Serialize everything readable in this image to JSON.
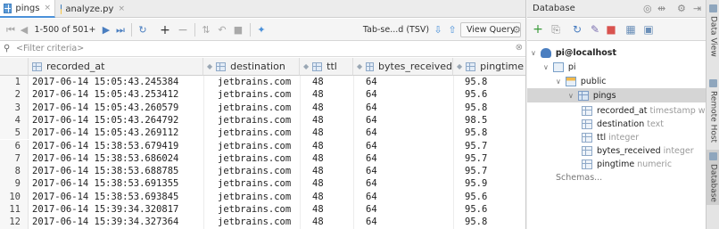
{
  "editor": {
    "tabs": [
      {
        "label": "pings",
        "active": true,
        "icon": "table-icon"
      },
      {
        "label": "analyze.py",
        "active": false,
        "icon": "python-file-icon"
      }
    ],
    "close_glyph": "×",
    "toolbar": {
      "range": "1-500 of 501+",
      "format": "Tab-se...d (TSV)",
      "view_query": "View Query"
    },
    "filter_placeholder": "<Filter criteria>",
    "columns": [
      {
        "name": "recorded_at"
      },
      {
        "name": "destination"
      },
      {
        "name": "ttl"
      },
      {
        "name": "bytes_received"
      },
      {
        "name": "pingtime"
      }
    ],
    "rows": [
      {
        "n": "1",
        "recorded_at": "2017-06-14 15:05:43.245384",
        "destination": "jetbrains.com",
        "ttl": "48",
        "bytes_received": "64",
        "pingtime": "95.8"
      },
      {
        "n": "2",
        "recorded_at": "2017-06-14 15:05:43.253412",
        "destination": "jetbrains.com",
        "ttl": "48",
        "bytes_received": "64",
        "pingtime": "95.6"
      },
      {
        "n": "3",
        "recorded_at": "2017-06-14 15:05:43.260579",
        "destination": "jetbrains.com",
        "ttl": "48",
        "bytes_received": "64",
        "pingtime": "95.8"
      },
      {
        "n": "4",
        "recorded_at": "2017-06-14 15:05:43.264792",
        "destination": "jetbrains.com",
        "ttl": "48",
        "bytes_received": "64",
        "pingtime": "98.5"
      },
      {
        "n": "5",
        "recorded_at": "2017-06-14 15:05:43.269112",
        "destination": "jetbrains.com",
        "ttl": "48",
        "bytes_received": "64",
        "pingtime": "95.8"
      },
      {
        "n": "6",
        "recorded_at": "2017-06-14 15:38:53.679419",
        "destination": "jetbrains.com",
        "ttl": "48",
        "bytes_received": "64",
        "pingtime": "95.7"
      },
      {
        "n": "7",
        "recorded_at": "2017-06-14 15:38:53.686024",
        "destination": "jetbrains.com",
        "ttl": "48",
        "bytes_received": "64",
        "pingtime": "95.7"
      },
      {
        "n": "8",
        "recorded_at": "2017-06-14 15:38:53.688785",
        "destination": "jetbrains.com",
        "ttl": "48",
        "bytes_received": "64",
        "pingtime": "95.7"
      },
      {
        "n": "9",
        "recorded_at": "2017-06-14 15:38:53.691355",
        "destination": "jetbrains.com",
        "ttl": "48",
        "bytes_received": "64",
        "pingtime": "95.9"
      },
      {
        "n": "10",
        "recorded_at": "2017-06-14 15:38:53.693845",
        "destination": "jetbrains.com",
        "ttl": "48",
        "bytes_received": "64",
        "pingtime": "95.6"
      },
      {
        "n": "11",
        "recorded_at": "2017-06-14 15:39:34.320817",
        "destination": "jetbrains.com",
        "ttl": "48",
        "bytes_received": "64",
        "pingtime": "95.6"
      },
      {
        "n": "12",
        "recorded_at": "2017-06-14 15:39:34.327364",
        "destination": "jetbrains.com",
        "ttl": "48",
        "bytes_received": "64",
        "pingtime": "95.8"
      }
    ]
  },
  "database": {
    "title": "Database",
    "tree": {
      "connection": "pi@localhost",
      "database": "pi",
      "schema": "public",
      "table": "pings",
      "columns": [
        {
          "name": "recorded_at",
          "type": "timestamp wit"
        },
        {
          "name": "destination",
          "type": "text"
        },
        {
          "name": "ttl",
          "type": "integer"
        },
        {
          "name": "bytes_received",
          "type": "integer"
        },
        {
          "name": "pingtime",
          "type": "numeric"
        }
      ],
      "schemas_label": "Schemas..."
    }
  },
  "side_tabs": [
    "Data View",
    "Remote Host",
    "Database"
  ],
  "colors": {
    "accent": "#4a90d9",
    "selection": "#d5d5d5"
  }
}
